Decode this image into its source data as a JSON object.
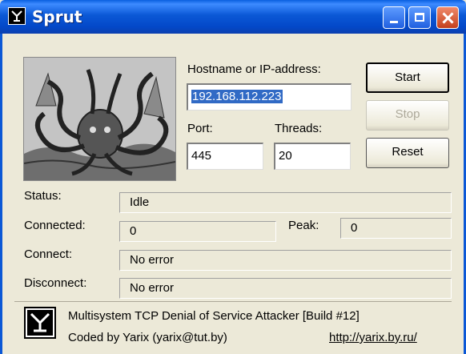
{
  "window": {
    "title": "Sprut"
  },
  "form": {
    "host_label": "Hostname or IP-address:",
    "host_value": "192.168.112.223",
    "port_label": "Port:",
    "port_value": "445",
    "threads_label": "Threads:",
    "threads_value": "20"
  },
  "buttons": {
    "start": "Start",
    "stop": "Stop",
    "reset": "Reset"
  },
  "status": {
    "status_label": "Status:",
    "status_value": "Idle",
    "connected_label": "Connected:",
    "connected_value": "0",
    "peak_label": "Peak:",
    "peak_value": "0",
    "connect_label": "Connect:",
    "connect_value": "No error",
    "disconnect_label": "Disconnect:",
    "disconnect_value": "No error"
  },
  "footer": {
    "description": "Multisystem TCP Denial of Service Attacker [Build #12]",
    "author": "Coded by Yarix (yarix@tut.by)",
    "url": "http://yarix.by.ru/"
  },
  "icons": {
    "app": "kraken-logo-icon",
    "footer_logo": "kraken-logo-icon"
  }
}
